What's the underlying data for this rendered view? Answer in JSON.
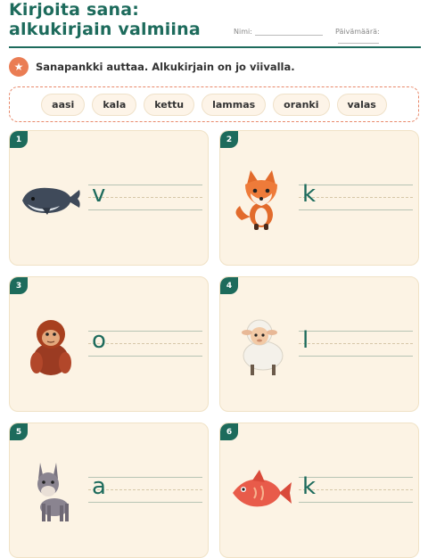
{
  "title": "Kirjoita sana: alkukirjain valmiina",
  "name_label": "Nimi:",
  "date_label": "Päivämäärä:",
  "instruction": "Sanapankki auttaa. Alkukirjain on jo viivalla.",
  "word_bank": [
    "aasi",
    "kala",
    "kettu",
    "lammas",
    "oranki",
    "valas"
  ],
  "items": [
    {
      "number": "1",
      "letter": "v",
      "animal": "whale-icon"
    },
    {
      "number": "2",
      "letter": "k",
      "animal": "fox-icon"
    },
    {
      "number": "3",
      "letter": "o",
      "animal": "orangutan-icon"
    },
    {
      "number": "4",
      "letter": "l",
      "animal": "sheep-icon"
    },
    {
      "number": "5",
      "letter": "a",
      "animal": "donkey-icon"
    },
    {
      "number": "6",
      "letter": "k",
      "animal": "fish-icon"
    }
  ],
  "colors": {
    "accent": "#1d6b5c",
    "orange": "#ea7d54",
    "card": "#fcf3e4"
  }
}
